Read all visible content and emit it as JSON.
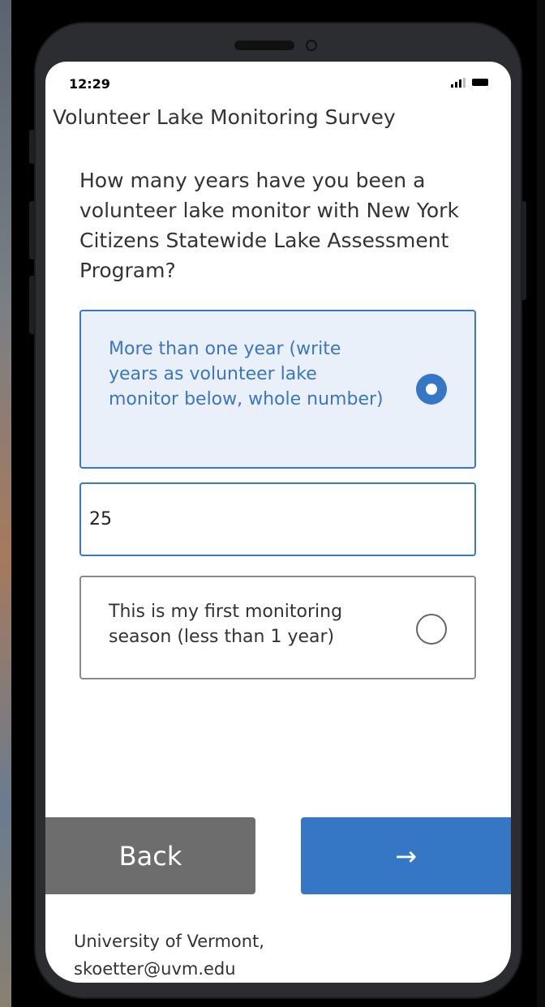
{
  "status_bar": {
    "time": "12:29"
  },
  "app": {
    "title": "Volunteer Lake Monitoring Survey"
  },
  "question": {
    "text": "How many years have you been a volunteer lake monitor with New York Citizens Statewide Lake Assessment Program?"
  },
  "options": [
    {
      "label": "More than one year (write years as volunteer lake monitor below, whole number)",
      "selected": true
    },
    {
      "label": "This is my first monitoring season (less than 1 year)",
      "selected": false
    }
  ],
  "years_input": {
    "value": "25"
  },
  "navigation": {
    "back_label": "Back",
    "next_label": "→"
  },
  "footer": {
    "line1": "University of Vermont,",
    "line2": "skoetter@uvm.edu"
  },
  "colors": {
    "accent": "#3577c5",
    "selected_bg": "#e9f0fa",
    "back_button": "#6d6d6d"
  }
}
